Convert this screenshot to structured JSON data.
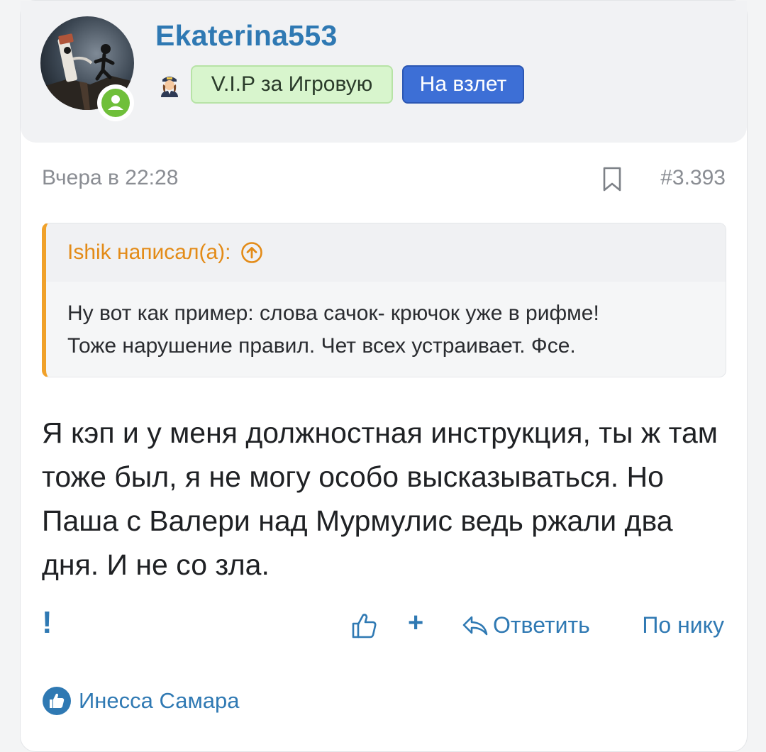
{
  "post": {
    "author": "Ekaterina553",
    "badges": {
      "vip": "V.I.P за Игровую",
      "takeoff": "На взлет"
    },
    "date": "Вчера в 22:28",
    "number": "#3.393",
    "quote": {
      "author": "Ishik написал(а):",
      "lines": [
        "Ну вот как пример: слова сачок- крючок уже в рифме!",
        "Тоже нарушение правил. Чет всех устраивает. Фсе."
      ]
    },
    "message": "Я кэп и у меня должностная инструкция, ты ж там тоже был, я не могу особо высказываться. Но Паша с Валери над Мурмулис ведь ржали два дня. И не со зла.",
    "actions": {
      "report": "!",
      "plus": "+",
      "reply": "Ответить",
      "by_nick": "По нику"
    },
    "reactions": {
      "user": "Инесса Самара"
    }
  },
  "colors": {
    "link": "#2f79b3",
    "quote_accent": "#f0a12a",
    "vip_badge_bg": "#d8f5cd",
    "takeoff_badge_bg": "#3d6fd6",
    "online": "#6fbf3a"
  },
  "icons": [
    "online-user-icon",
    "pilot-rank-icon",
    "bookmark-icon",
    "arrow-up-circle-icon",
    "like-icon",
    "reply-arrow-icon",
    "like-reaction-icon"
  ]
}
